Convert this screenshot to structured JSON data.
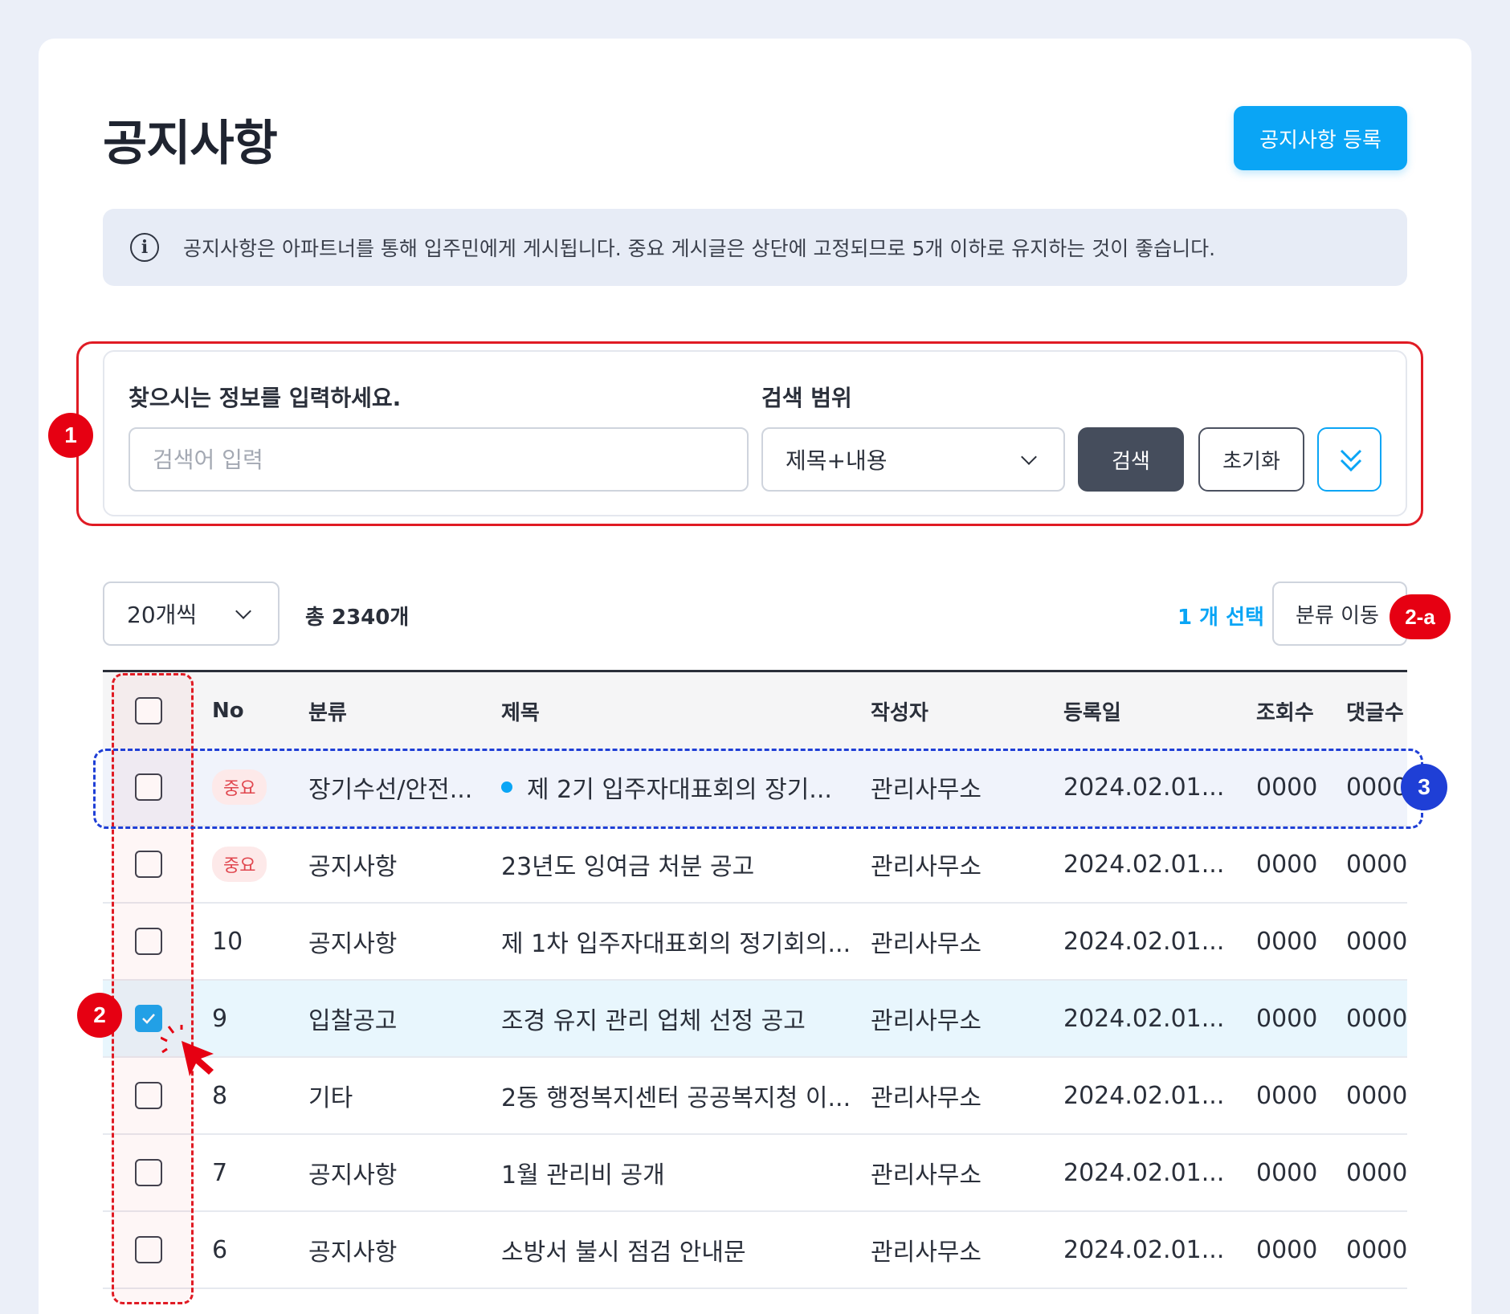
{
  "page": {
    "title": "공지사항",
    "register_label": "공지사항 등록",
    "info_text": "공지사항은 아파트너를 통해 입주민에게 게시됩니다. 중요 게시글은 상단에 고정되므로 5개 이하로 유지하는 것이 좋습니다."
  },
  "search": {
    "keyword_label": "찾으시는 정보를 입력하세요.",
    "keyword_placeholder": "검색어 입력",
    "keyword_value": "",
    "range_label": "검색 범위",
    "range_value": "제목+내용",
    "search_label": "검색",
    "reset_label": "초기화"
  },
  "toolbar": {
    "per_page": "20개씩",
    "total": "총 2340개",
    "selected": "1 개 선택",
    "move_label": "분류 이동"
  },
  "annotations": {
    "a1": "1",
    "a2": "2",
    "a2a": "2-a",
    "a3": "3"
  },
  "table": {
    "headers": {
      "no": "No",
      "category": "분류",
      "title": "제목",
      "author": "작성자",
      "date": "등록일",
      "views": "조회수",
      "comments": "댓글수"
    },
    "rows": [
      {
        "no": "중요",
        "category": "장기수선/안전...",
        "title": "제 2기 입주자대표회의 장기...",
        "author": "관리사무소",
        "date": "2024.02.01...",
        "views": "0000",
        "comments": "0000",
        "checked": false,
        "important": true
      },
      {
        "no": "중요",
        "category": "공지사항",
        "title": "23년도 잉여금 처분 공고",
        "author": "관리사무소",
        "date": "2024.02.01...",
        "views": "0000",
        "comments": "0000",
        "checked": false,
        "important": true
      },
      {
        "no": "10",
        "category": "공지사항",
        "title": "제 1차 입주자대표회의 정기회의...",
        "author": "관리사무소",
        "date": "2024.02.01...",
        "views": "0000",
        "comments": "0000",
        "checked": false,
        "important": false
      },
      {
        "no": "9",
        "category": "입찰공고",
        "title": "조경 유지 관리 업체 선정 공고",
        "author": "관리사무소",
        "date": "2024.02.01...",
        "views": "0000",
        "comments": "0000",
        "checked": true,
        "important": false
      },
      {
        "no": "8",
        "category": "기타",
        "title": "2동 행정복지센터 공공복지청 이...",
        "author": "관리사무소",
        "date": "2024.02.01...",
        "views": "0000",
        "comments": "0000",
        "checked": false,
        "important": false
      },
      {
        "no": "7",
        "category": "공지사항",
        "title": "1월 관리비 공개",
        "author": "관리사무소",
        "date": "2024.02.01...",
        "views": "0000",
        "comments": "0000",
        "checked": false,
        "important": false
      },
      {
        "no": "6",
        "category": "공지사항",
        "title": "소방서 불시 점검 안내문",
        "author": "관리사무소",
        "date": "2024.02.01...",
        "views": "0000",
        "comments": "0000",
        "checked": false,
        "important": false
      }
    ]
  },
  "colors": {
    "accent": "#0aa5f5",
    "dark_button": "#454d5c",
    "annotation_red": "#e60012",
    "annotation_blue": "#1f3fd6"
  }
}
